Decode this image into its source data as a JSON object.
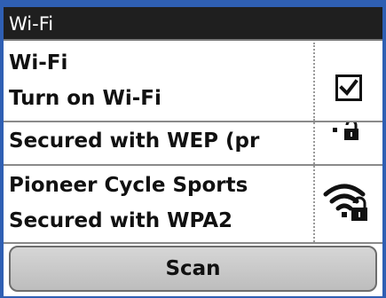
{
  "header": {
    "title": "Wi-Fi"
  },
  "wifi_toggle": {
    "title": "Wi-Fi",
    "subtitle": "Turn on Wi-Fi",
    "checked": true
  },
  "networks": [
    {
      "name": "",
      "security": "Secured with WEP (pr",
      "icon": "wifi-locked-icon"
    },
    {
      "name": "Pioneer Cycle Sports",
      "security": "Secured with WPA2",
      "icon": "wifi-locked-icon"
    }
  ],
  "actions": {
    "scan_label": "Scan"
  },
  "colors": {
    "frame": "#2f5fb3",
    "titlebar": "#1f1f1f",
    "text": "#111111",
    "button": "#c8c8c8"
  }
}
